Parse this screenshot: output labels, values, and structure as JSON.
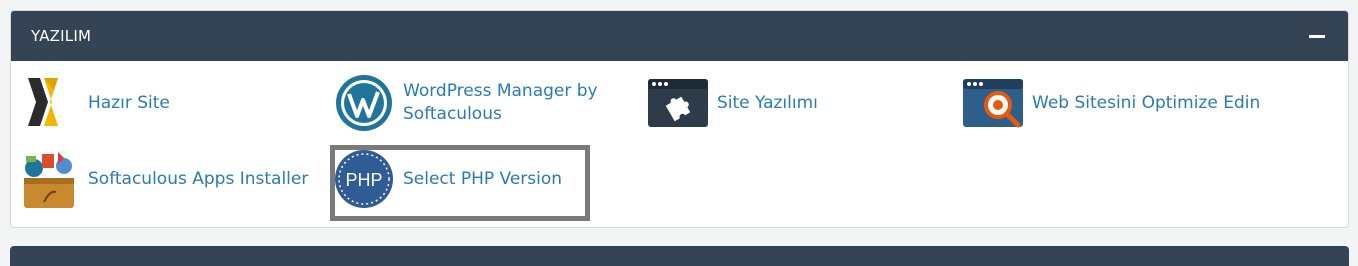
{
  "panel": {
    "title": "YAZILIM",
    "collapse_label": "collapse"
  },
  "items": [
    {
      "label": "Hazır Site",
      "icon": "hazir-site-icon"
    },
    {
      "label": "WordPress Manager by Softaculous",
      "label_line1": "WordPress Manager by",
      "label_line2": "Softaculous",
      "icon": "wordpress-icon"
    },
    {
      "label": "Site Yazılımı",
      "icon": "site-software-icon"
    },
    {
      "label": "Web Sitesini Optimize Edin",
      "icon": "optimize-website-icon"
    },
    {
      "label": "Softaculous Apps Installer",
      "icon": "softaculous-icon"
    },
    {
      "label": "Select PHP Version",
      "icon": "php-icon",
      "icon_text": "PHP"
    }
  ],
  "colors": {
    "header_bg": "#344455",
    "link": "#2a7bb5",
    "highlight_border": "#7a7a7a"
  }
}
